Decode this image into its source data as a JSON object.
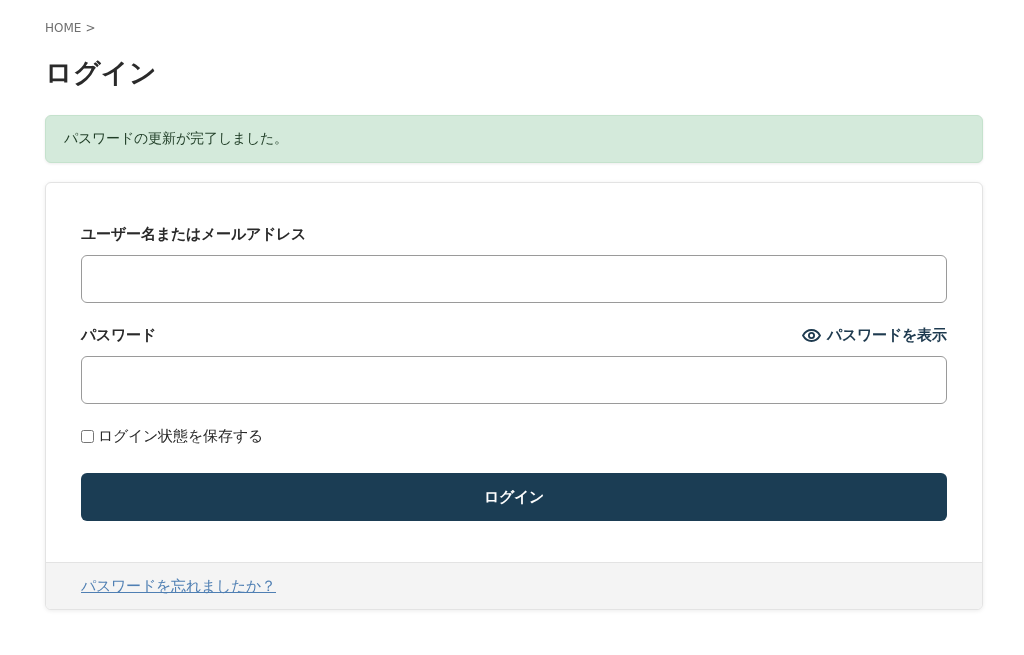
{
  "breadcrumb": {
    "label": "HOME",
    "separator": ">"
  },
  "title": "ログイン",
  "notice": {
    "kind": "success",
    "message": "パスワードの更新が完了しました。"
  },
  "form": {
    "fields": [
      {
        "label": "ユーザー名またはメールアドレス"
      },
      {
        "label": "パスワード",
        "toggle": {
          "label": "パスワードを表示"
        }
      }
    ],
    "remember": {
      "label": "ログイン状態を保存する",
      "checked": false
    },
    "submit": "ログイン",
    "footer_link": "パスワードを忘れましたか？"
  }
}
